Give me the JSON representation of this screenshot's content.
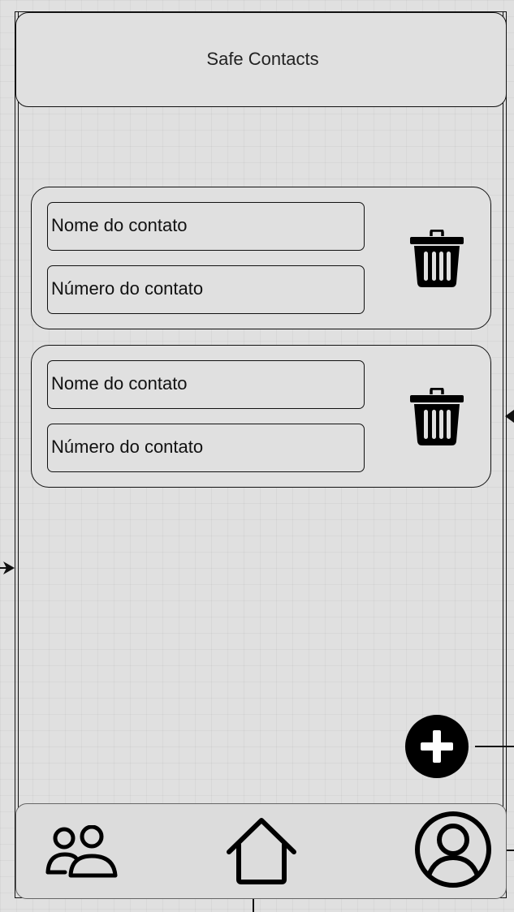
{
  "header": {
    "title": "Safe Contacts"
  },
  "contacts": [
    {
      "name_placeholder": "Nome do contato",
      "number_placeholder": "Número do contato",
      "delete_icon": "trash-icon"
    },
    {
      "name_placeholder": "Nome do contato",
      "number_placeholder": "Número do contato",
      "delete_icon": "trash-icon"
    }
  ],
  "add_button": {
    "icon": "plus-circle-icon"
  },
  "bottom_nav": {
    "items": [
      {
        "icon": "contacts-icon"
      },
      {
        "icon": "home-icon"
      },
      {
        "icon": "profile-icon"
      }
    ]
  },
  "colors": {
    "background": "#e0e0e0",
    "stroke": "#111111",
    "nav_border": "#666666"
  }
}
